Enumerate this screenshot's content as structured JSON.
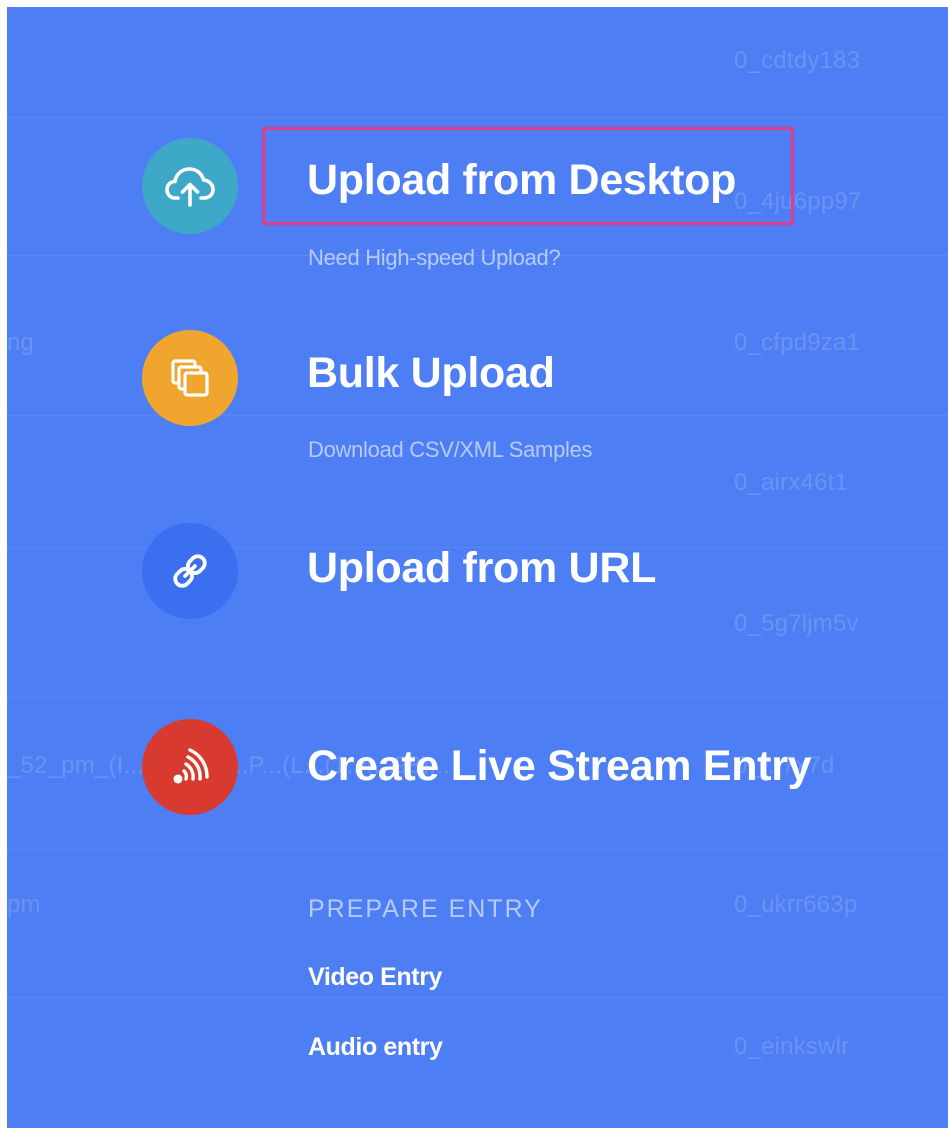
{
  "background_list": {
    "ids": [
      "0_cdtdy183",
      "0_4ju6pp97",
      "0_cfpd9za1",
      "0_airx46t1",
      "0_5g7ljm5v",
      "0_...7x7d",
      "0_ukrr663p",
      "0_einkswlr"
    ],
    "names": [
      "ng",
      "_52_pm_(I...30_-_Vi...P...(L...(1..4...98)...",
      "pm"
    ]
  },
  "upload_menu": {
    "items": [
      {
        "title": "Upload from Desktop",
        "subtitle": "Need High-speed Upload?",
        "icon": "cloud-upload-icon",
        "icon_color": "#3ea8c9"
      },
      {
        "title": "Bulk Upload",
        "subtitle": "Download CSV/XML Samples",
        "icon": "copy-icon",
        "icon_color": "#f0a52e"
      },
      {
        "title": "Upload from URL",
        "subtitle": "",
        "icon": "link-icon",
        "icon_color": "#3b6ff0"
      },
      {
        "title": "Create Live Stream Entry",
        "subtitle": "",
        "icon": "broadcast-icon",
        "icon_color": "#d93a30"
      }
    ],
    "prepare_entry": {
      "label": "PREPARE ENTRY",
      "links": [
        "Video Entry",
        "Audio entry"
      ]
    }
  },
  "colors": {
    "overlay_bg": "#4d7ef4",
    "highlight_border": "#e33b8a",
    "title": "#ffffff",
    "subtitle": "#b7cbfa"
  }
}
